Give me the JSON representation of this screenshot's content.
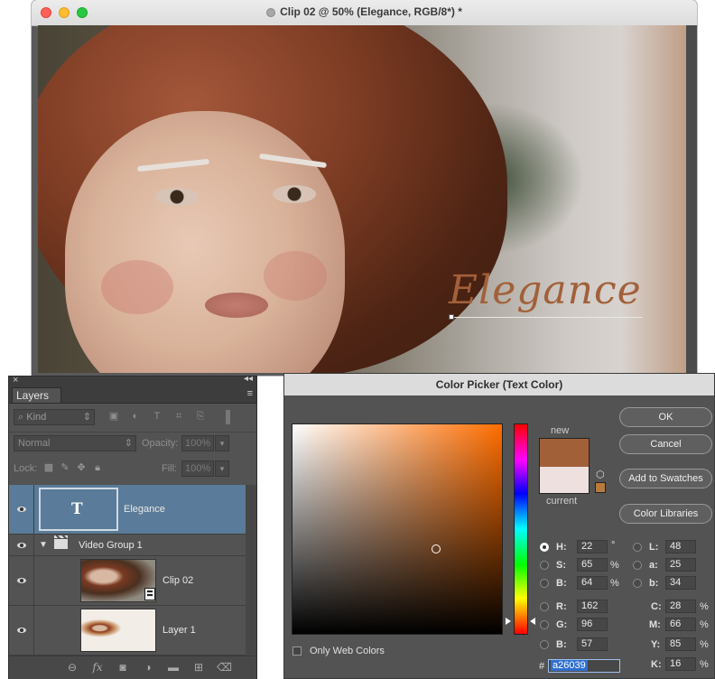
{
  "document": {
    "title": "Clip 02 @ 50% (Elegance, RGB/8*) *",
    "canvas_text": "Elegance",
    "text_color": "#a26039"
  },
  "layers_panel": {
    "tab_label": "Layers",
    "close_glyph": "×",
    "collapse_glyph": "◂◂",
    "menu_glyph": "≡",
    "filter_kind": "Kind",
    "blend_mode": "Normal",
    "opacity_label": "Opacity:",
    "opacity_value": "100%",
    "lock_label": "Lock:",
    "fill_label": "Fill:",
    "fill_value": "100%",
    "layers": [
      {
        "name": "Elegance",
        "type": "text",
        "thumb_glyph": "T",
        "selected": true
      },
      {
        "name": "Video Group 1",
        "type": "group"
      },
      {
        "name": "Clip 02",
        "type": "video"
      },
      {
        "name": "Layer 1",
        "type": "image"
      }
    ],
    "footer_icons": [
      "link-icon",
      "fx-icon",
      "mask-icon",
      "adjustment-icon",
      "folder-icon",
      "new-layer-icon",
      "trash-icon"
    ],
    "footer_fx": "fx"
  },
  "color_picker": {
    "title": "Color Picker (Text Color)",
    "label_new": "new",
    "label_current": "current",
    "new_color": "#a26039",
    "current_color": "#ede0df",
    "buttons": {
      "ok": "OK",
      "cancel": "Cancel",
      "add_swatches": "Add to Swatches",
      "libraries": "Color Libraries"
    },
    "hsb": {
      "h": "22",
      "h_unit": "°",
      "s": "65",
      "s_unit": "%",
      "b": "64",
      "b_unit": "%"
    },
    "rgb": {
      "r": "162",
      "g": "96",
      "b": "57"
    },
    "lab": {
      "l": "48",
      "a": "25",
      "b": "34"
    },
    "cmyk": {
      "c": "28",
      "m": "66",
      "y": "85",
      "k": "16"
    },
    "labels": {
      "h": "H:",
      "s": "S:",
      "b": "B:",
      "r": "R:",
      "g": "G:",
      "b2": "B:",
      "l": "L:",
      "a": "a:",
      "lb": "b:",
      "c": "C:",
      "m": "M:",
      "y": "Y:",
      "k": "K:"
    },
    "percent": "%",
    "hex_prefix": "#",
    "hex_value": "a26039",
    "web_colors_label": "Only Web Colors"
  }
}
